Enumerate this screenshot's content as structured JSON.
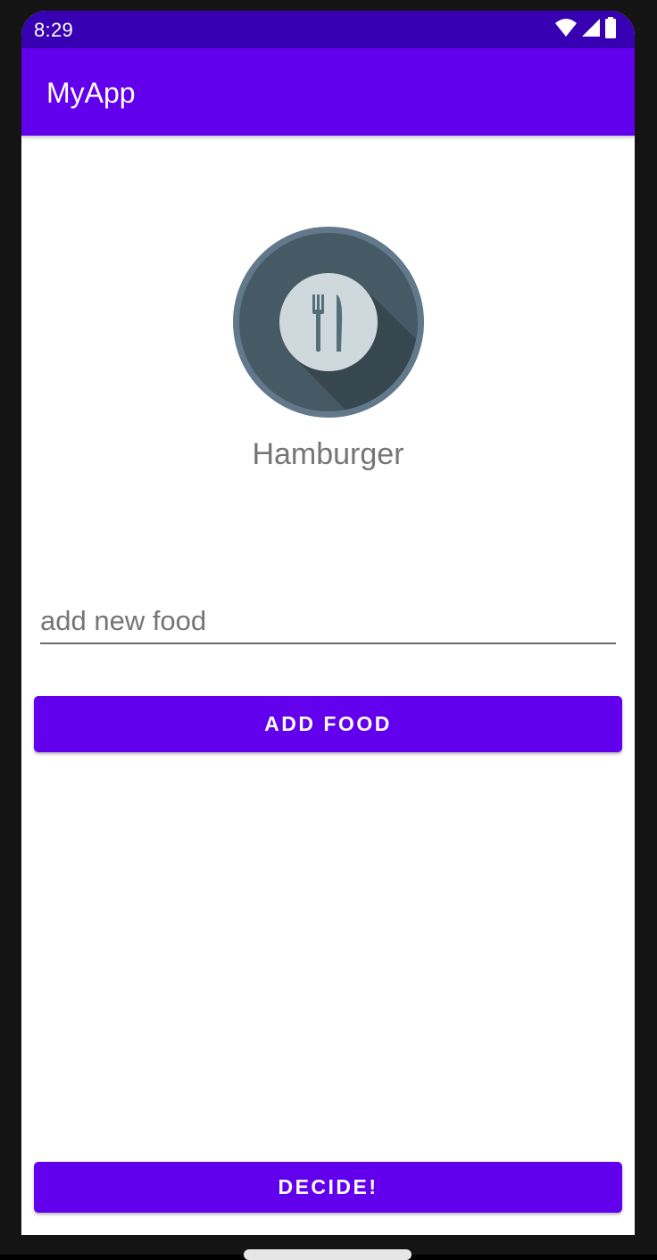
{
  "status_bar": {
    "time": "8:29",
    "icons": [
      "wifi-icon",
      "signal-icon",
      "battery-icon"
    ]
  },
  "app_bar": {
    "title": "MyApp"
  },
  "main": {
    "image_icon": "fork-knife-plate-icon",
    "food_name": "Hamburger",
    "new_food_input": {
      "value": "",
      "placeholder": "add new food"
    },
    "add_button_label": "ADD FOOD",
    "decide_button_label": "DECIDE!"
  },
  "colors": {
    "primary": "#6200ee",
    "primary_dark": "#3700b3",
    "plate_outer": "#62788b",
    "plate_inner": "#455a64",
    "plate_center": "#cfd8dc"
  }
}
